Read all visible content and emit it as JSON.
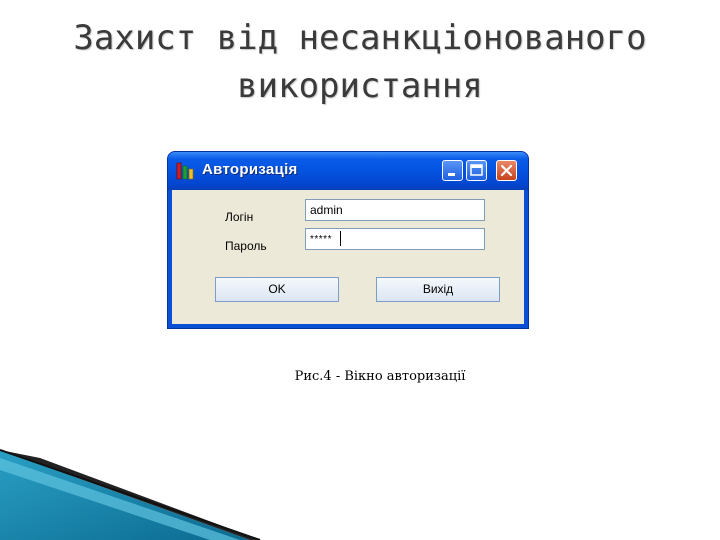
{
  "slide": {
    "title_line1": "Захист від несанкціонованого",
    "title_line2": "використання"
  },
  "window": {
    "title": "Авторизація",
    "login_label": "Логін",
    "password_label": "Пароль",
    "login_value": "admin",
    "password_value": "*****",
    "ok_label": "OK",
    "exit_label": "Вихід",
    "icons": [
      "app-icon",
      "minimize-icon",
      "maximize-icon",
      "close-icon"
    ]
  },
  "caption": "Рис.4 - Вікно авторизації",
  "colors": {
    "titlebar": "#0452e0",
    "client_bg": "#ece9d8",
    "close_button": "#c8431c"
  }
}
